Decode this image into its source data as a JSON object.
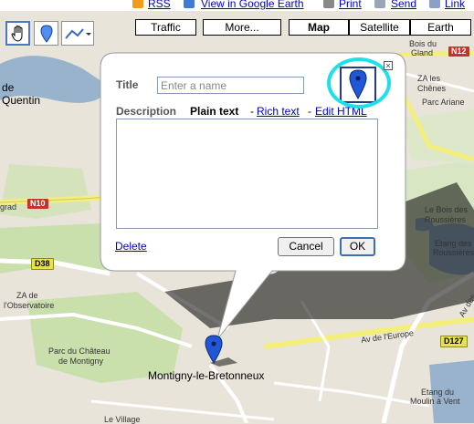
{
  "top_links": {
    "rss": "RSS",
    "view_in_google_earth": "View in Google Earth",
    "print": "Print",
    "send": "Send",
    "link": "Link"
  },
  "toolbar": {
    "hand_tool": "hand-icon",
    "placemark_tool": "placemark-icon",
    "line_tool": "line-icon"
  },
  "map_types": {
    "traffic": "Traffic",
    "more": "More...",
    "map": "Map",
    "satellite": "Satellite",
    "earth": "Earth",
    "selected": "Map"
  },
  "map_labels": {
    "de": "de",
    "quentin": "Quentin",
    "bois_du": "Bois du",
    "gland": "Gland",
    "n12": "N12",
    "za_les": "ZA les",
    "chenes": "Chênes",
    "parc_ariane": "Parc Ariane",
    "grad": "grad",
    "n10": "N10",
    "le_bois_des": "Le Bois des",
    "rousseres": "Roussières",
    "etang_des": "Etang des",
    "roussieres_2": "Roussières",
    "d38": "D38",
    "za_de": "ZA de",
    "l_observatoire": "l'Observatoire",
    "av_de_leurope": "Av de l'Europe",
    "av_des": "Av des",
    "d127": "D127",
    "parc_du_chateau": "Parc du Château",
    "de_montigny": "de Montigny",
    "montigny": "Montigny-le-Bretonneux",
    "etang_du": "Etang du",
    "moulin_a_vent": "Moulin à Vent",
    "le_village": "Le Village"
  },
  "popup": {
    "title_label": "Title",
    "title_value": "",
    "title_placeholder": "Enter a name",
    "description_label": "Description",
    "mode_plain": "Plain text",
    "sep1": "-",
    "mode_rich": "Rich text",
    "sep2": "-",
    "mode_html": "Edit HTML",
    "description_value": "",
    "delete": "Delete",
    "cancel": "Cancel",
    "ok": "OK",
    "close": "close-icon",
    "marker_icon": "placemark-icon"
  },
  "colors": {
    "link": "#0000cc",
    "highlight_ring": "#1fe0e8",
    "marker": "#1f57d6",
    "shield_red": "#c8312b",
    "road_yellow": "#f4ee7c"
  }
}
